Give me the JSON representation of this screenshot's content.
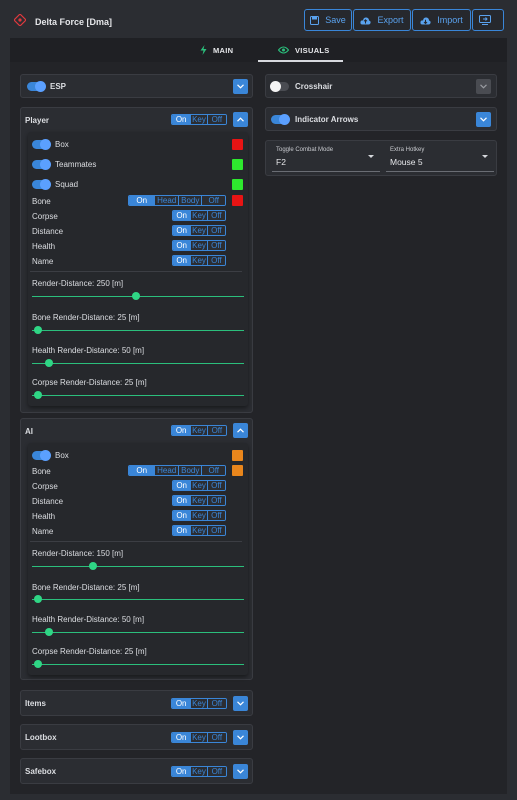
{
  "app": {
    "title": "Delta Force [Dma]"
  },
  "toolbar": {
    "save": "Save",
    "export": "Export",
    "import": "Import"
  },
  "tabs": {
    "main": "MAIN",
    "visuals": "VISUALS"
  },
  "colors": {
    "accent": "#3a86d8",
    "slider": "#2fd685",
    "red": "#e81414",
    "green": "#2ee82e",
    "orange": "#e9861c"
  },
  "icons": {
    "logo": "crosshair-logo-icon",
    "save": "save-icon",
    "export": "cloud-upload-icon",
    "import": "cloud-download-icon",
    "window": "window-icon",
    "main": "bolt-icon",
    "visuals": "eye-icon"
  },
  "esp": {
    "label": "ESP",
    "enabled": true
  },
  "crosshair": {
    "label": "Crosshair",
    "enabled": false
  },
  "indicator_arrows": {
    "label": "Indicator Arrows",
    "enabled": true
  },
  "toggle_combat_mode": {
    "label": "Toggle Combat Mode",
    "value": "F2"
  },
  "extra_hotkey": {
    "label": "Extra Hotkey",
    "value": "Mouse 5"
  },
  "mode": {
    "on": "On",
    "key": "Key",
    "off": "Off"
  },
  "bone_mode": {
    "on": "On",
    "head": "Head",
    "body": "Body",
    "off": "Off"
  },
  "player": {
    "label": "Player",
    "box": "Box",
    "teammates": "Teammates",
    "squad": "Squad",
    "bone": "Bone",
    "corpse": "Corpse",
    "distance": "Distance",
    "health": "Health",
    "name": "Name",
    "render_distance": {
      "label": "Render-Distance: 250 [m]",
      "value": 250,
      "fraction": 0.49
    },
    "bone_render_distance": {
      "label": "Bone Render-Distance: 25 [m]",
      "value": 25,
      "fraction": 0.03
    },
    "health_render_distance": {
      "label": "Health Render-Distance: 50 [m]",
      "value": 50,
      "fraction": 0.08
    },
    "corpse_render_distance": {
      "label": "Corpse Render-Distance: 25 [m]",
      "value": 25,
      "fraction": 0.03
    }
  },
  "ai": {
    "label": "AI",
    "box": "Box",
    "bone": "Bone",
    "corpse": "Corpse",
    "distance": "Distance",
    "health": "Health",
    "name": "Name",
    "render_distance": {
      "label": "Render-Distance: 150 [m]",
      "value": 150,
      "fraction": 0.29
    },
    "bone_render_distance": {
      "label": "Bone Render-Distance: 25 [m]",
      "value": 25,
      "fraction": 0.03
    },
    "health_render_distance": {
      "label": "Health Render-Distance: 50 [m]",
      "value": 50,
      "fraction": 0.08
    },
    "corpse_render_distance": {
      "label": "Corpse Render-Distance: 25 [m]",
      "value": 25,
      "fraction": 0.03
    }
  },
  "items": {
    "label": "Items"
  },
  "lootbox": {
    "label": "Lootbox"
  },
  "safebox": {
    "label": "Safebox"
  }
}
